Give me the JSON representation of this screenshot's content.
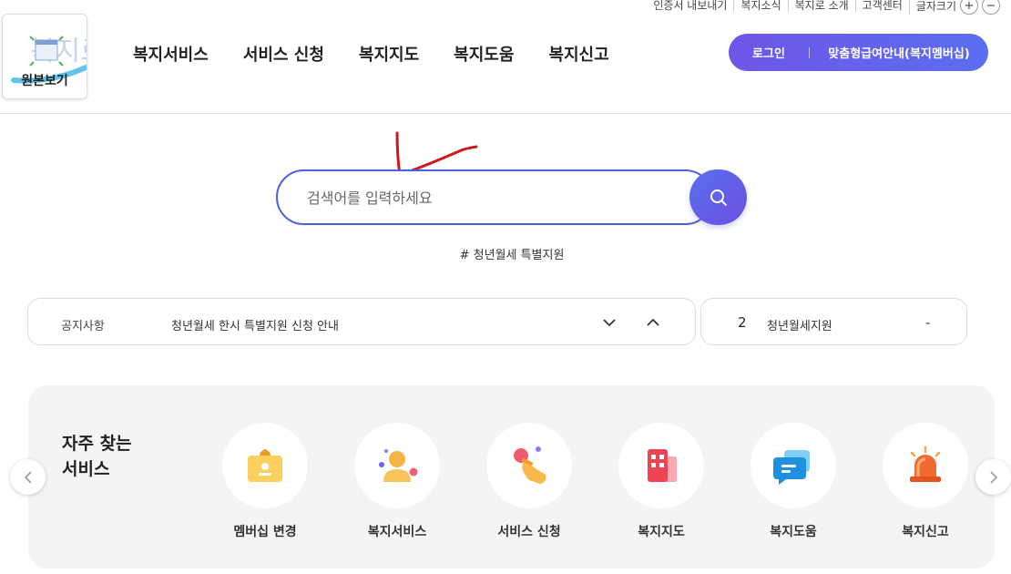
{
  "utility_bar": {
    "links": [
      "인증서 내보내기",
      "복지소식",
      "복지로 소개",
      "고객센터"
    ],
    "font_size_label": "글자크기",
    "increase": "+",
    "decrease": "−"
  },
  "logo": {
    "label": "원본보기"
  },
  "nav": {
    "items": [
      "복지서비스",
      "서비스 신청",
      "복지지도",
      "복지도움",
      "복지신고"
    ]
  },
  "login": {
    "login_label": "로그인",
    "membership_label": "맞춤형급여안내(복지멤버십)"
  },
  "search": {
    "placeholder": "검색어를 입력하세요",
    "icon": "search-icon"
  },
  "hashtag": "# 청년월세 특별지원",
  "notice": {
    "label": "공지사항",
    "text": "청년월세 한시 특별지원 신청 안내",
    "down_icon": "chevron-down-icon",
    "up_icon": "chevron-up-icon"
  },
  "popular": {
    "rank": "2",
    "keyword": "청년월세지원",
    "change": "-"
  },
  "services": {
    "title": "자주 찾는\n서비스",
    "items": [
      {
        "label": "멤버십 변경",
        "icon": "id-badge-icon"
      },
      {
        "label": "복지서비스",
        "icon": "person-icon"
      },
      {
        "label": "서비스 신청",
        "icon": "hand-click-icon"
      },
      {
        "label": "복지지도",
        "icon": "building-icon"
      },
      {
        "label": "복지도움",
        "icon": "chat-bubble-icon"
      },
      {
        "label": "복지신고",
        "icon": "siren-icon"
      }
    ]
  },
  "colors": {
    "primary": "#5a6ef0",
    "purple": "#6f55e8",
    "annotation": "#d0171b"
  }
}
